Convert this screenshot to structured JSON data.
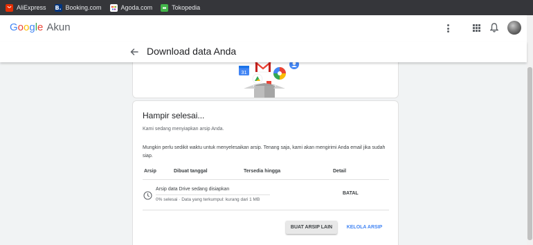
{
  "bookmarks": [
    {
      "label": "AliExpress",
      "icon": "aliexpress-icon",
      "color": "#e62e04",
      "glyph": ""
    },
    {
      "label": "Booking.com",
      "icon": "booking-icon",
      "color": "#003580",
      "glyph": "B."
    },
    {
      "label": "Agoda.com",
      "icon": "agoda-icon",
      "color": "#ffffff",
      "glyph": ""
    },
    {
      "label": "Tokopedia",
      "icon": "tokopedia-icon",
      "color": "#42b549",
      "glyph": ""
    }
  ],
  "header": {
    "logo_letters": [
      "G",
      "o",
      "o",
      "g",
      "l",
      "e"
    ],
    "app_name": "Akun"
  },
  "subheader": {
    "title": "Download data Anda"
  },
  "main": {
    "heading": "Hampir selesai...",
    "intro": "Kami sedang menyiapkan arsip Anda.",
    "note": "Mungkin perlu sedikit waktu untuk menyelesaikan arsip. Tenang saja, kami akan mengirimi Anda email jika sudah siap.",
    "columns": [
      "Arsip",
      "Dibuat tanggal",
      "Tersedia hingga",
      "Detail"
    ],
    "archive": {
      "name": "Arsip data Drive sedang disiapkan",
      "status": "0% selesai · Data yang terkumpul: kurang dari 1 MB",
      "progress_percent": 0,
      "action": "BATAL"
    },
    "buttons": {
      "new_archive": "BUAT ARSIP LAIN",
      "manage": "KELOLA ARSIP"
    },
    "illustration_calendar_day": "31"
  },
  "colors": {
    "accent_blue": "#4285f4",
    "bookmarks_bg": "#35363a",
    "page_bg": "#f1f3f4"
  }
}
